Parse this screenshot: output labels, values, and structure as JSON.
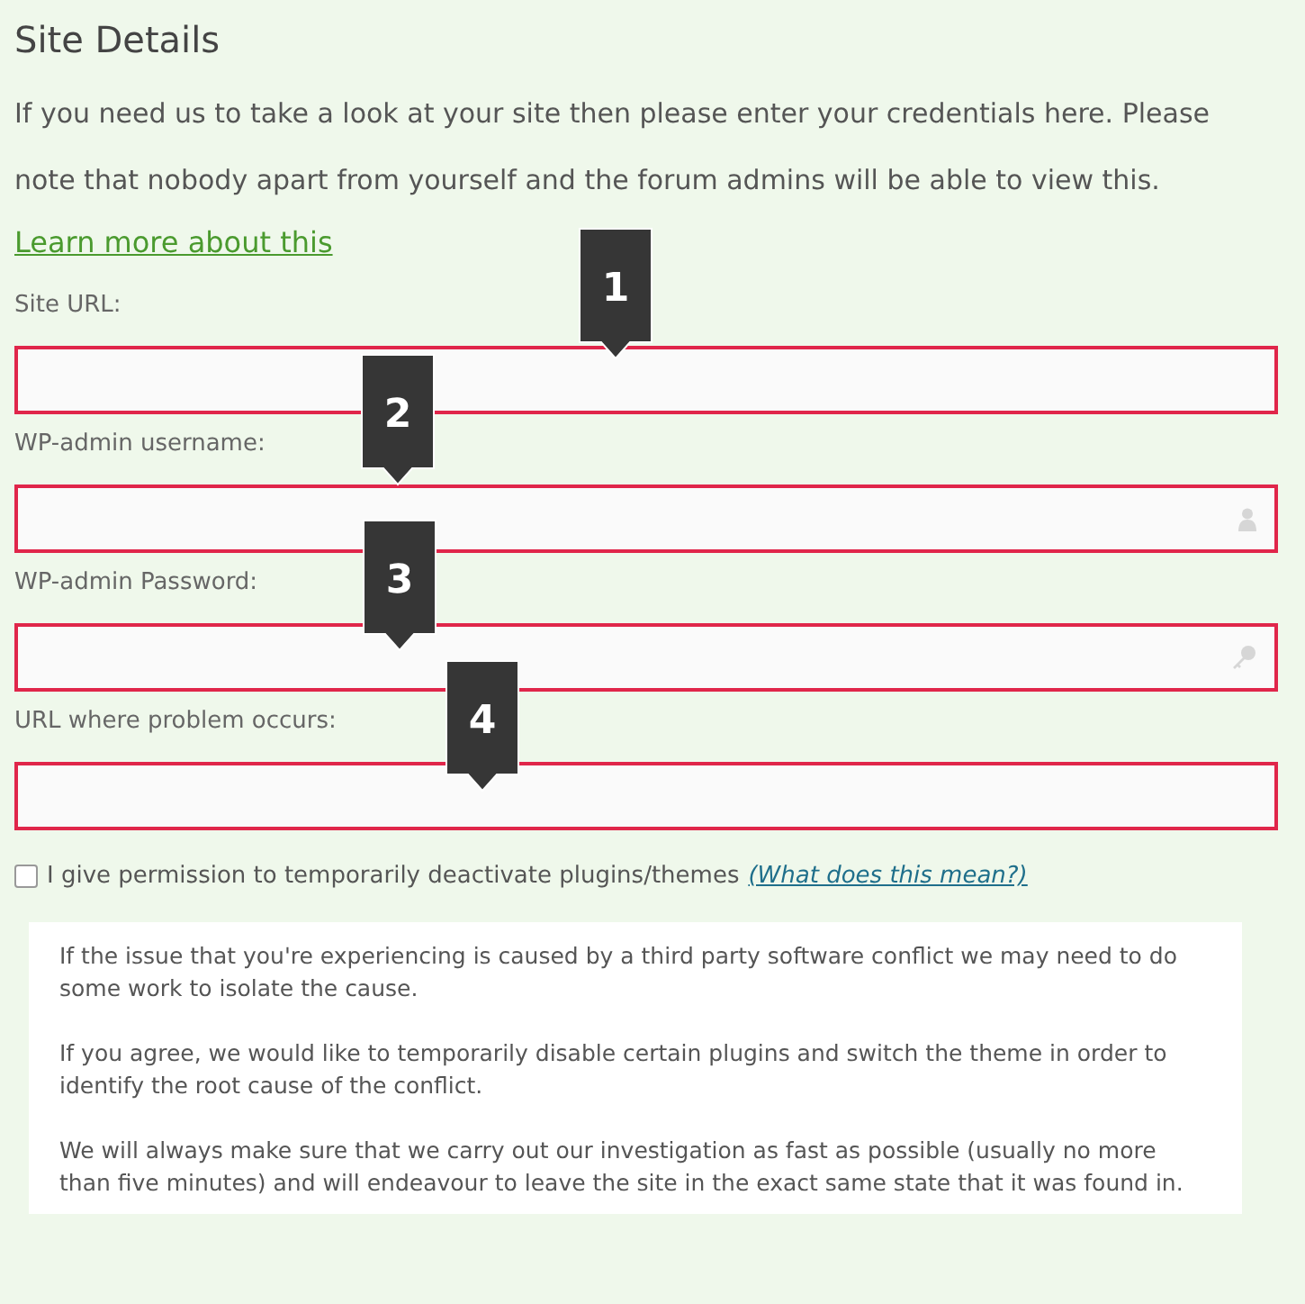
{
  "heading": "Site Details",
  "intro": "If you need us to take a look at your site then please enter your credentials here. Please note that nobody apart from yourself and the forum admins will be able to view this.",
  "learn_more_link": "Learn more about this",
  "fields": [
    {
      "label": "Site URL:",
      "kind": "url",
      "marker": "1"
    },
    {
      "label": "WP-admin username:",
      "kind": "username",
      "marker": "2"
    },
    {
      "label": "WP-admin Password:",
      "kind": "password",
      "marker": "3"
    },
    {
      "label": "URL where problem occurs:",
      "kind": "url",
      "marker": "4"
    }
  ],
  "permission": {
    "label": "I give permission to temporarily deactivate plugins/themes",
    "checked": false,
    "link": "(What does this mean?)"
  },
  "info": [
    "If the issue that you're experiencing is caused by a third party software conflict we may need to do some work to isolate the cause.",
    "If you agree, we would like to temporarily disable certain plugins and switch the theme in order to identify the root cause of the conflict.",
    "We will always make sure that we carry out our investigation as fast as possible (usually no more than five minutes) and will endeavour to leave the site in the exact same state that it was found in."
  ]
}
